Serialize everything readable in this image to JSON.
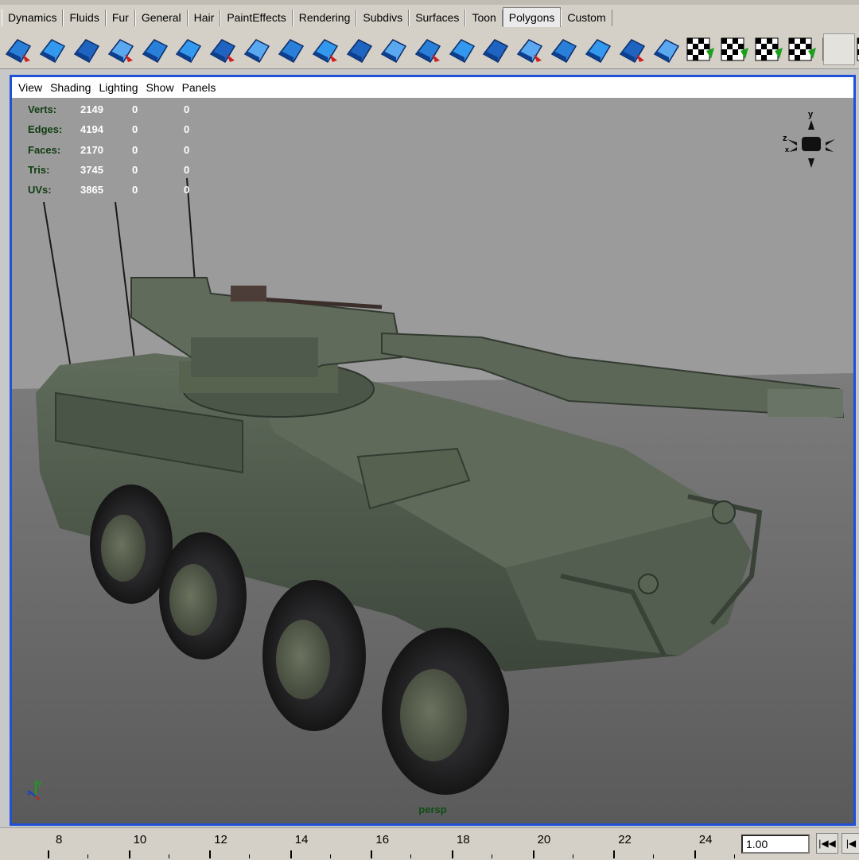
{
  "shelf_tabs": [
    "Dynamics",
    "Fluids",
    "Fur",
    "General",
    "Hair",
    "PaintEffects",
    "Rendering",
    "Subdivs",
    "Surfaces",
    "Toon",
    "Polygons",
    "Custom"
  ],
  "active_tab": "Polygons",
  "shelf_icons": [
    "poly-sphere-select-icon",
    "poly-combine-icon",
    "poly-extract-icon",
    "poly-sphere-icon",
    "poly-smooth-proxy-icon",
    "poly-cube-face-icon",
    "poly-append-icon",
    "poly-extrude-face-icon",
    "poly-extrude-edge-icon",
    "poly-duplicate-face-icon",
    "poly-bevel-icon",
    "poly-merge-icon",
    "poly-collapse-icon",
    "poly-split-icon",
    "poly-cut-icon",
    "poly-subdivide-icon",
    "poly-wedge-icon",
    "poly-poke-icon",
    "poly-chamfer-icon",
    "poly-normal-icon",
    "planar-map-icon",
    "auto-map-icon",
    "cylindrical-map-icon",
    "spherical-map-icon",
    "uv-texture-editor-icon",
    "uv-snapshot-icon"
  ],
  "panel_menu": [
    "View",
    "Shading",
    "Lighting",
    "Show",
    "Panels"
  ],
  "hud": [
    {
      "label": "Verts:",
      "v1": "2149",
      "v2": "0",
      "v3": "0"
    },
    {
      "label": "Edges:",
      "v1": "4194",
      "v2": "0",
      "v3": "0"
    },
    {
      "label": "Faces:",
      "v1": "2170",
      "v2": "0",
      "v3": "0"
    },
    {
      "label": "Tris:",
      "v1": "3745",
      "v2": "0",
      "v3": "0"
    },
    {
      "label": "UVs:",
      "v1": "3865",
      "v2": "0",
      "v3": "0"
    }
  ],
  "view_cube_axes": {
    "y": "y",
    "z": "z",
    "x": "x"
  },
  "camera_name": "persp",
  "timeline_ticks": [
    "8",
    "10",
    "12",
    "14",
    "16",
    "18",
    "20",
    "22",
    "24"
  ],
  "current_frame": "1.00",
  "colors": {
    "panel_border": "#1e50d8",
    "hud_label": "#113d11",
    "camera_label": "#0e4d14",
    "tank_green": "#4f5a4c"
  }
}
